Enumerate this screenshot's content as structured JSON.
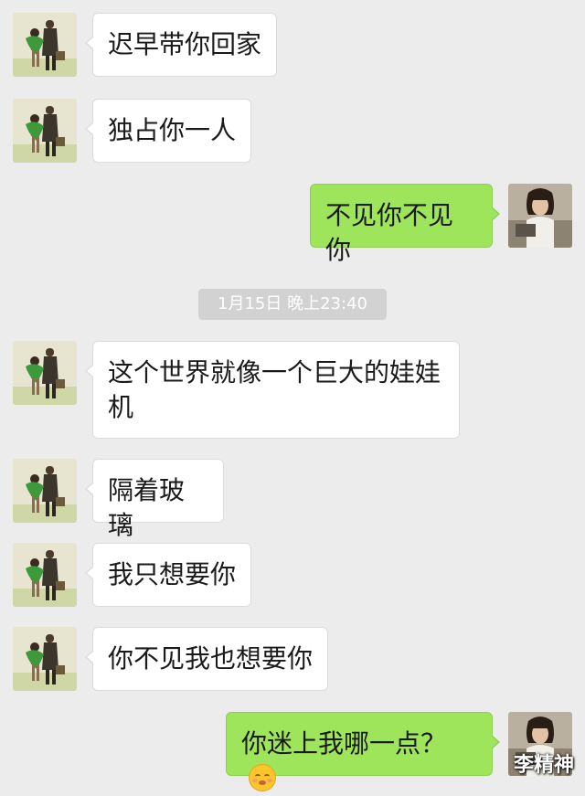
{
  "timestamp": "1月15日 晚上23:40",
  "watermark": "李精神",
  "messages": [
    {
      "side": "in",
      "text": "迟早带你回家"
    },
    {
      "side": "in",
      "text": "独占你一人"
    },
    {
      "side": "out",
      "text": "不见你不见你"
    },
    {
      "side": "in",
      "text": "这个世界就像一个巨大的娃娃机"
    },
    {
      "side": "in",
      "text": "隔着玻璃"
    },
    {
      "side": "in",
      "text": "我只想要你"
    },
    {
      "side": "in",
      "text": "你不见我也想要你"
    },
    {
      "side": "out",
      "text": "你迷上我哪一点？",
      "emoji": "blushing-smile-emoji"
    }
  ],
  "avatars": {
    "incoming": "leon-and-mathilda-avatar",
    "outgoing": "short-hair-girl-avatar"
  },
  "colors": {
    "background": "#ececec",
    "incoming_bubble": "#ffffff",
    "outgoing_bubble": "#9ee55b",
    "timestamp_pill": "#d2d2d2"
  }
}
